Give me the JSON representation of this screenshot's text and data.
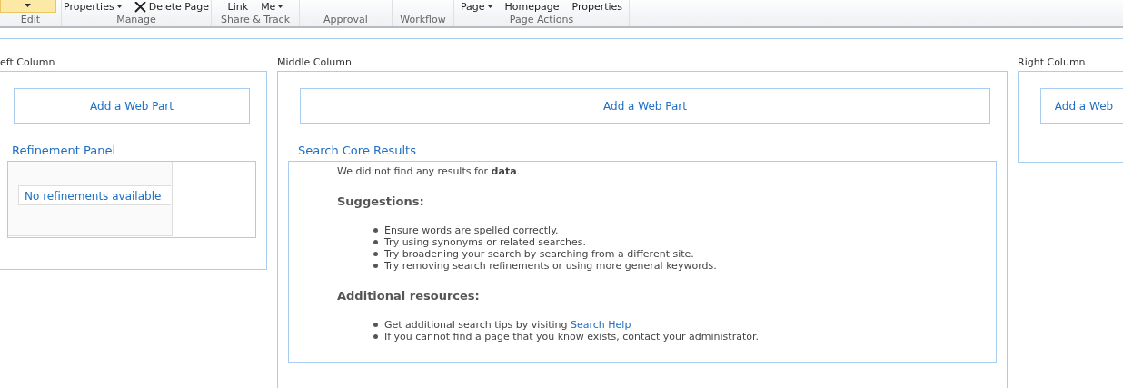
{
  "ribbon": {
    "groups": [
      {
        "label": "Edit",
        "items": [
          {
            "kind": "caret-button"
          }
        ]
      },
      {
        "label": "Manage",
        "items": [
          {
            "kind": "dropdown",
            "label": "Properties"
          },
          {
            "kind": "delete",
            "label": "Delete Page"
          }
        ]
      },
      {
        "label": "Share & Track",
        "items": [
          {
            "kind": "plain",
            "label": "Link"
          },
          {
            "kind": "dropdown",
            "label": "Me"
          }
        ]
      },
      {
        "label": "Approval"
      },
      {
        "label": "Workflow"
      },
      {
        "label": "Page Actions",
        "items": [
          {
            "kind": "dropdown",
            "label": "Page"
          },
          {
            "kind": "plain",
            "label": "Homepage"
          },
          {
            "kind": "plain",
            "label": "Properties"
          }
        ]
      }
    ]
  },
  "zones": [
    {
      "label": "eft Column",
      "add_web_part": "Add a Web Part",
      "web_part": {
        "kind": "refinement",
        "title": "Refinement Panel",
        "message": "No refinements available"
      }
    },
    {
      "label": "Middle Column",
      "add_web_part": "Add a Web Part",
      "web_part": {
        "kind": "results",
        "title": "Search Core Results",
        "intro": "We did not find any results for **data**.",
        "sections": [
          {
            "heading": "Suggestions:",
            "items": [
              {
                "text": "Ensure words are spelled correctly."
              },
              {
                "text": "Try using synonyms or related searches."
              },
              {
                "text": "Try broadening your search by searching from a different site."
              },
              {
                "text": "Try removing search refinements or using more general keywords."
              }
            ]
          },
          {
            "heading": "Additional resources:",
            "items": [
              {
                "text": "Get additional search tips by visiting ",
                "link": "Search Help"
              },
              {
                "text": "If you cannot find a page that you know exists, contact your administrator."
              }
            ]
          }
        ]
      }
    },
    {
      "label": "Right Column",
      "add_web_part": "Add a Web"
    }
  ]
}
